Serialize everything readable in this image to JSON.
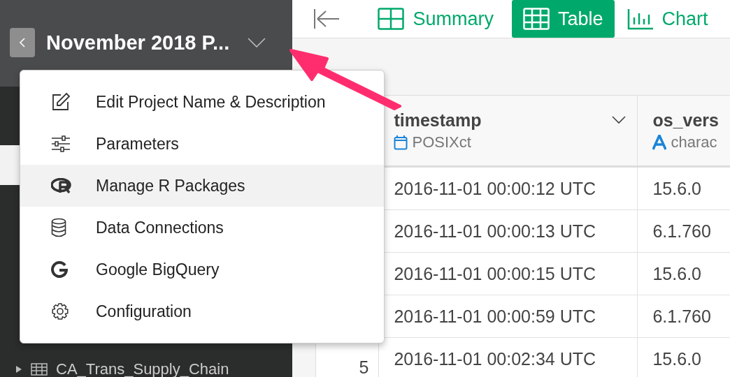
{
  "project": {
    "title": "November 2018 P..."
  },
  "menu": {
    "items": [
      {
        "label": "Edit Project Name & Description",
        "selected": false
      },
      {
        "label": "Parameters",
        "selected": false
      },
      {
        "label": "Manage R Packages",
        "selected": true
      },
      {
        "label": "Data Connections",
        "selected": false
      },
      {
        "label": "Google BigQuery",
        "selected": false
      },
      {
        "label": "Configuration",
        "selected": false
      }
    ]
  },
  "sidebar": {
    "items": [
      {
        "label": "CA_Trans_Supply_Chain",
        "expanded": false
      }
    ]
  },
  "view_tabs": [
    {
      "label": "Summary",
      "selected": false
    },
    {
      "label": "Table",
      "selected": true
    },
    {
      "label": "Chart",
      "selected": false
    }
  ],
  "table": {
    "columns": [
      {
        "name": "timestamp",
        "type": "POSIXct",
        "kind": "date"
      },
      {
        "name": "os_vers",
        "type": "charac",
        "kind": "text"
      }
    ],
    "rows": [
      {
        "cells": [
          "2016-11-01 00:00:12 UTC",
          "15.6.0"
        ]
      },
      {
        "cells": [
          "2016-11-01 00:00:13 UTC",
          "6.1.760"
        ]
      },
      {
        "cells": [
          "2016-11-01 00:00:15 UTC",
          "15.6.0"
        ]
      },
      {
        "cells": [
          "2016-11-01 00:00:59 UTC",
          "6.1.760"
        ]
      },
      {
        "number": "5",
        "cells": [
          "2016-11-01 00:02:34 UTC",
          "15.6.0"
        ]
      }
    ]
  }
}
